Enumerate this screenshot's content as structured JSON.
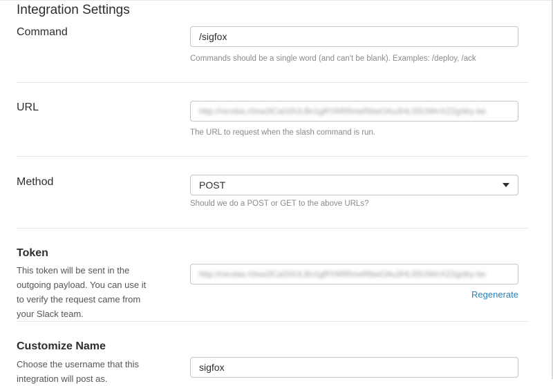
{
  "page": {
    "title": "Integration Settings"
  },
  "command": {
    "label": "Command",
    "value": "/sigfox",
    "help": "Commands should be a single word (and can't be blank). Examples: /deploy, /ack"
  },
  "url": {
    "label": "URL",
    "value": "http://nicolas.r0xw2lCaG0ULBn1gRYARRmeRbwOAu3HL55UWrrXZ2g/dry-be",
    "help": "The URL to request when the slash command is run."
  },
  "method": {
    "label": "Method",
    "value": "POST",
    "help": "Should we do a POST or GET to the above URLs?"
  },
  "token": {
    "label": "Token",
    "description": "This token will be sent in the outgoing payload. You can use it to verify the request came from your Slack team.",
    "value": "http://nicolas.r0xw2lCaG0ULBn1gRYARRmeRbwOAu3HL55UWrrXZ2g/dry-be",
    "regenerate_label": "Regenerate"
  },
  "customize_name": {
    "label": "Customize Name",
    "description": "Choose the username that this integration will post as.",
    "value": "sigfox"
  }
}
